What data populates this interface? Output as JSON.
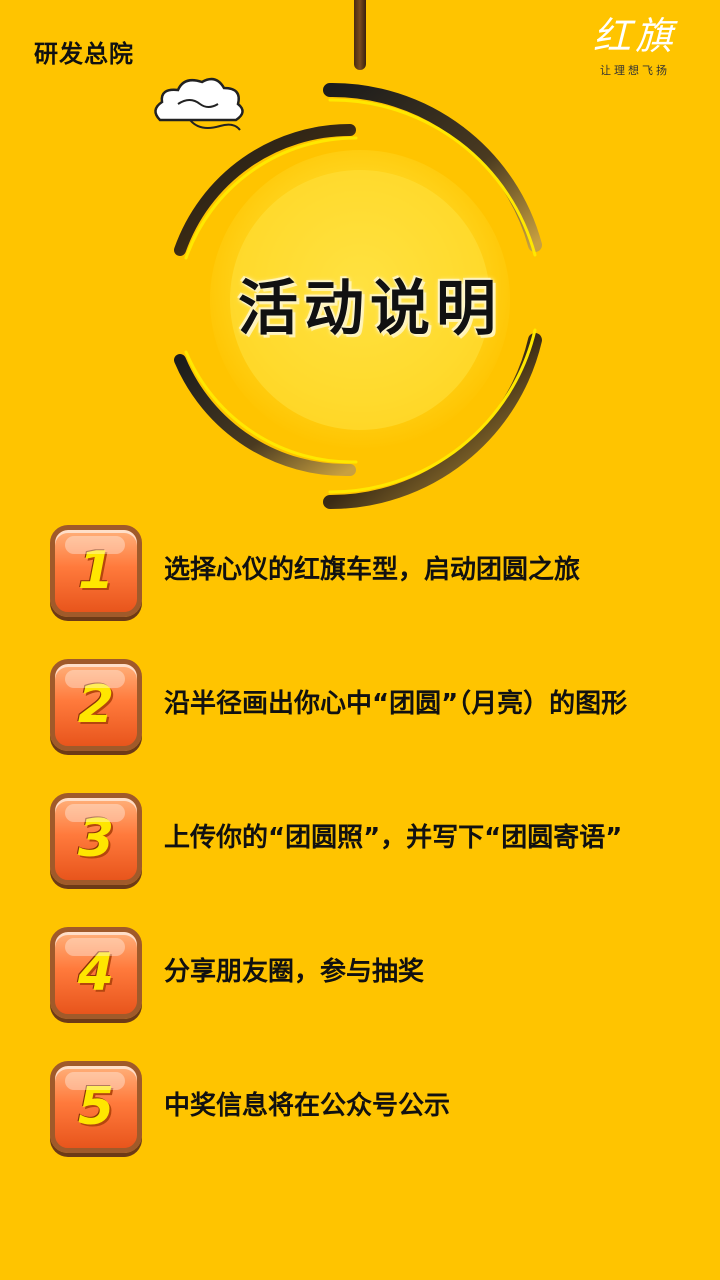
{
  "header": {
    "org_name": "研发总院",
    "logo_mark": "红旗",
    "logo_slogan": "让理想飞扬"
  },
  "hero": {
    "title": "活动说明"
  },
  "steps": [
    {
      "number": "1",
      "text": "选择心仪的红旗车型，启动团圆之旅"
    },
    {
      "number": "2",
      "text": "沿半径画出你心中“团圆”（月亮）的图形"
    },
    {
      "number": "3",
      "text": "上传你的“团圆照”，并写下“团圆寄语”"
    },
    {
      "number": "4",
      "text": "分享朋友圈，参与抽奖"
    },
    {
      "number": "5",
      "text": "中奖信息将在公众号公示"
    }
  ],
  "colors": {
    "background": "#FFC400",
    "badge": "#FF7A3C",
    "badge_number": "#FFE600",
    "text": "#111111"
  }
}
